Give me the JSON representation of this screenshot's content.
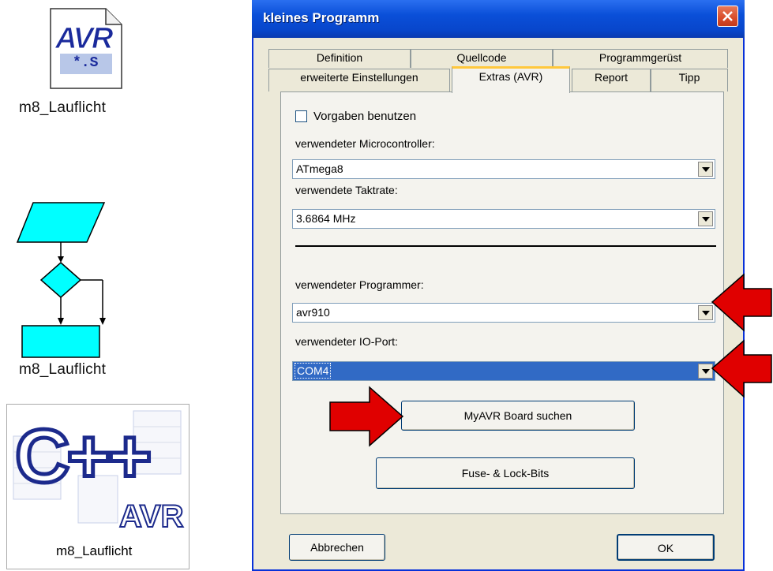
{
  "desktop": {
    "icons": [
      {
        "label": "m8_Lauflicht",
        "file_badge": "AVR",
        "file_ext": "*.S"
      },
      {
        "label": "m8_Lauflicht"
      },
      {
        "label": "m8_Lauflicht",
        "logo_text": "C++",
        "logo_sub": "AVR"
      }
    ]
  },
  "dialog": {
    "title": "kleines Programm",
    "tabs_row1": [
      "Definition",
      "Quellcode",
      "Programmgerüst"
    ],
    "tabs_row2": [
      "erweiterte Einstellungen",
      "Extras (AVR)",
      "Report",
      "Tipp"
    ],
    "active_tab": "Extras (AVR)",
    "checkbox_label": "Vorgaben benutzen",
    "checkbox_checked": false,
    "microcontroller_label": "verwendeter Microcontroller:",
    "microcontroller_value": "ATmega8",
    "clock_label": "verwendete Taktrate:",
    "clock_value": "3.6864 MHz",
    "programmer_label": "verwendeter Programmer:",
    "programmer_value": "avr910",
    "ioport_label": "verwendeter IO-Port:",
    "ioport_value": "COM4",
    "search_button": "MyAVR Board suchen",
    "fuse_button": "Fuse- & Lock-Bits",
    "cancel_button": "Abbrechen",
    "ok_button": "OK"
  },
  "colors": {
    "titlebar": "#0a4fd8",
    "selection": "#316ac5",
    "flowchart_fill": "#00ffff",
    "annotation_arrow": "#e00000"
  }
}
